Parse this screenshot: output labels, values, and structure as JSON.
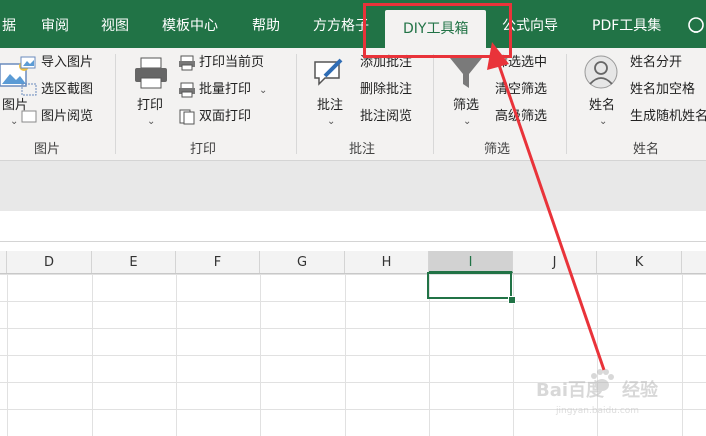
{
  "tabs": [
    {
      "label": "据"
    },
    {
      "label": "审阅"
    },
    {
      "label": "视图"
    },
    {
      "label": "模板中心"
    },
    {
      "label": "帮助"
    },
    {
      "label": "方方格子"
    },
    {
      "label": "DIY工具箱",
      "active": true
    },
    {
      "label": "公式向导"
    },
    {
      "label": "PDF工具集"
    }
  ],
  "ribbon": {
    "picture_group": {
      "big_label": "图片",
      "items": [
        "导入图片",
        "选区截图",
        "图片阅览"
      ],
      "group_label": "图片"
    },
    "print_group": {
      "big_label": "打印",
      "items": [
        "打印当前页",
        "批量打印",
        "双面打印"
      ],
      "group_label": "打印"
    },
    "comment_group": {
      "big_label": "批注",
      "items": [
        "添加批注",
        "删除批注",
        "批注阅览"
      ],
      "group_label": "批注"
    },
    "filter_group": {
      "big_label": "筛选",
      "items": [
        "筛选选中",
        "清空筛选",
        "高级筛选"
      ],
      "group_label": "筛选"
    },
    "name_group": {
      "big_label": "姓名",
      "items": [
        "姓名分开",
        "姓名加空格",
        "生成随机姓名"
      ],
      "group_label": "姓名"
    }
  },
  "columns": [
    "D",
    "E",
    "F",
    "G",
    "H",
    "I",
    "J",
    "K"
  ],
  "selected_column": "I",
  "colors": {
    "brand": "#217346",
    "annotation": "#e9333a"
  },
  "watermark": {
    "logo": "Bai百度",
    "text": "经验",
    "sub": "jingyan.baidu.com"
  }
}
